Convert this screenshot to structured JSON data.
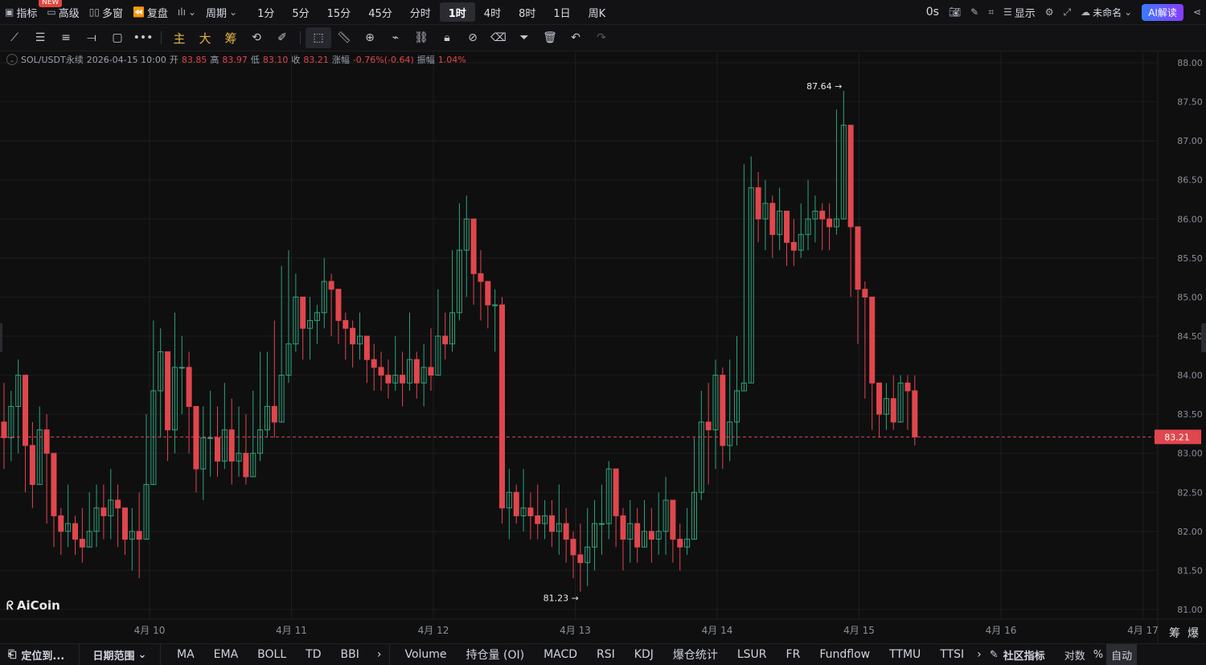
{
  "topbar": {
    "new_badge": "NEW",
    "indicators": "指标",
    "advanced": "高级",
    "multi_window": "多窗",
    "replay": "复盘",
    "period_menu": "周期",
    "periods": [
      "1分",
      "5分",
      "15分",
      "45分",
      "分时",
      "1时",
      "4时",
      "8时",
      "1日",
      "周K"
    ],
    "active_period": "1时",
    "countdown": "0s",
    "display": "显示",
    "layout_name": "未命名",
    "ai_button": "AI解读"
  },
  "toolbar": {
    "cn_tools": [
      "主",
      "大",
      "筹"
    ]
  },
  "info": {
    "symbol": "SOL/USDT永续",
    "datetime": "2026-04-15 10:00",
    "open_label": "开",
    "open": "83.85",
    "high_label": "高",
    "high": "83.97",
    "low_label": "低",
    "low": "83.10",
    "close_label": "收",
    "close": "83.21",
    "change_label": "涨幅",
    "change": "-0.76%(-0.64)",
    "amp_label": "振幅",
    "amp": "1.04%"
  },
  "chart_data": {
    "type": "candlestick",
    "symbol": "SOL/USDT永续",
    "interval": "1时",
    "ylim": [
      81.0,
      88.0
    ],
    "y_ticks": [
      "88.00",
      "87.50",
      "87.00",
      "86.50",
      "86.00",
      "85.50",
      "85.00",
      "84.50",
      "84.00",
      "83.50",
      "83.00",
      "82.50",
      "82.00",
      "81.50",
      "81.00"
    ],
    "x_ticks": [
      "4月 10",
      "4月 11",
      "4月 12",
      "4月 13",
      "4月 14",
      "4月 15",
      "4月 16",
      "4月 17"
    ],
    "last_price": "83.21",
    "high_marker": "87.64 →",
    "low_marker": "81.23 →",
    "colors": {
      "up": "#2ea37c",
      "down": "#e0464d",
      "last_line": "#e0464d"
    },
    "closes": [
      83.2,
      83.6,
      84.0,
      83.1,
      82.6,
      83.3,
      83.0,
      82.2,
      82.0,
      82.1,
      81.9,
      81.8,
      82.0,
      82.3,
      82.2,
      82.4,
      82.3,
      81.9,
      82.0,
      81.9,
      82.6,
      83.8,
      84.3,
      83.3,
      84.1,
      84.1,
      83.6,
      82.8,
      83.2,
      83.2,
      82.9,
      83.3,
      82.9,
      83.0,
      82.7,
      83.0,
      83.3,
      83.6,
      83.4,
      84.0,
      84.4,
      85.0,
      84.6,
      84.7,
      84.8,
      85.2,
      85.1,
      84.7,
      84.6,
      84.4,
      84.5,
      84.2,
      84.1,
      84.0,
      83.9,
      84.0,
      83.9,
      84.2,
      83.9,
      84.1,
      84.0,
      84.5,
      84.4,
      84.8,
      85.6,
      86.0,
      85.3,
      85.2,
      84.9,
      84.9,
      82.3,
      82.5,
      82.2,
      82.3,
      82.2,
      82.1,
      82.2,
      82.0,
      82.1,
      81.9,
      81.7,
      81.6,
      81.8,
      82.1,
      82.1,
      82.8,
      82.2,
      81.9,
      82.1,
      81.8,
      82.0,
      81.9,
      82.0,
      82.4,
      81.9,
      81.8,
      81.9,
      82.5,
      83.4,
      83.3,
      84.0,
      83.1,
      83.4,
      83.8,
      83.9,
      86.4,
      86.0,
      86.2,
      85.8,
      86.1,
      85.7,
      85.6,
      85.8,
      86.0,
      86.1,
      86.0,
      85.9,
      86.0,
      87.2,
      85.9,
      85.1,
      85.0,
      83.9,
      83.5,
      83.7,
      83.4,
      83.9,
      83.8,
      83.21
    ],
    "highs": [
      83.9,
      83.8,
      84.2,
      83.5,
      83.4,
      83.6,
      83.5,
      82.5,
      82.3,
      82.6,
      82.2,
      82.3,
      82.5,
      82.6,
      82.6,
      82.8,
      82.6,
      82.3,
      82.3,
      82.5,
      83.5,
      84.7,
      84.6,
      84.3,
      84.8,
      84.5,
      84.3,
      83.5,
      83.6,
      83.8,
      83.6,
      83.9,
      83.7,
      83.6,
      83.5,
      83.8,
      84.3,
      84.3,
      84.7,
      85.4,
      85.6,
      85.3,
      84.9,
      85.0,
      84.9,
      85.5,
      85.3,
      84.9,
      84.8,
      84.7,
      84.8,
      84.5,
      84.4,
      84.3,
      84.2,
      84.5,
      84.3,
      84.8,
      84.3,
      84.4,
      84.6,
      85.1,
      84.8,
      85.6,
      86.2,
      86.3,
      85.9,
      85.6,
      85.1,
      85.1,
      85.0,
      82.8,
      82.6,
      82.8,
      82.5,
      82.6,
      82.4,
      82.4,
      82.6,
      82.3,
      82.0,
      82.1,
      82.3,
      82.4,
      82.6,
      82.9,
      82.8,
      82.3,
      82.4,
      82.3,
      82.4,
      82.3,
      82.5,
      82.7,
      82.4,
      82.1,
      82.3,
      83.2,
      83.8,
      83.9,
      84.2,
      84.1,
      84.2,
      84.5,
      86.7,
      86.8,
      86.6,
      86.5,
      86.3,
      86.4,
      86.0,
      86.0,
      86.2,
      86.5,
      86.3,
      86.2,
      86.2,
      87.4,
      87.64,
      86.1,
      85.5,
      85.2,
      84.1,
      83.9,
      83.9,
      84.0,
      84.0,
      84.0,
      84.0
    ],
    "lows": [
      82.8,
      82.9,
      83.0,
      82.5,
      82.3,
      82.9,
      82.1,
      81.8,
      81.7,
      81.8,
      81.7,
      81.6,
      81.9,
      81.8,
      81.9,
      81.9,
      81.8,
      81.7,
      81.5,
      81.4,
      82.2,
      83.2,
      83.2,
      82.9,
      83.0,
      83.5,
      83.0,
      82.5,
      82.4,
      82.7,
      82.7,
      82.8,
      82.6,
      82.7,
      82.6,
      82.7,
      82.9,
      83.2,
      83.2,
      83.5,
      83.9,
      84.3,
      84.2,
      84.2,
      84.4,
      84.6,
      84.5,
      84.4,
      84.2,
      84.1,
      84.2,
      83.9,
      83.8,
      83.8,
      83.7,
      83.8,
      83.6,
      83.8,
      83.7,
      83.6,
      83.8,
      84.1,
      84.2,
      84.3,
      84.7,
      85.0,
      84.9,
      84.7,
      84.6,
      84.3,
      82.1,
      81.9,
      82.1,
      82.0,
      81.9,
      81.9,
      81.9,
      81.8,
      81.7,
      81.6,
      81.4,
      81.23,
      81.3,
      81.5,
      81.7,
      81.9,
      81.8,
      81.5,
      81.6,
      81.6,
      81.8,
      81.6,
      81.7,
      81.7,
      81.6,
      81.5,
      81.7,
      82.0,
      82.4,
      82.6,
      82.8,
      82.8,
      82.9,
      83.1,
      83.8,
      85.9,
      85.7,
      85.6,
      85.5,
      85.6,
      85.4,
      85.4,
      85.5,
      85.6,
      85.7,
      85.6,
      85.6,
      85.8,
      86.0,
      85.0,
      84.4,
      83.7,
      83.3,
      83.2,
      83.3,
      83.3,
      83.4,
      83.3,
      83.1
    ]
  },
  "bottombar": {
    "locate": "定位到...",
    "date_range": "日期范围",
    "main_indicators": [
      "MA",
      "EMA",
      "BOLL",
      "TD",
      "BBI"
    ],
    "sub_indicators": [
      "Volume",
      "持仓量 (OI)",
      "MACD",
      "RSI",
      "KDJ",
      "爆仓统计",
      "LSUR",
      "FR",
      "Fundflow",
      "TTMU",
      "TTSI"
    ],
    "community": "社区指标",
    "log": "对数",
    "percent": "%",
    "auto": "自动"
  },
  "side_labels": {
    "chips": "筹",
    "liq": "爆"
  },
  "logo_text": "AiCoin"
}
